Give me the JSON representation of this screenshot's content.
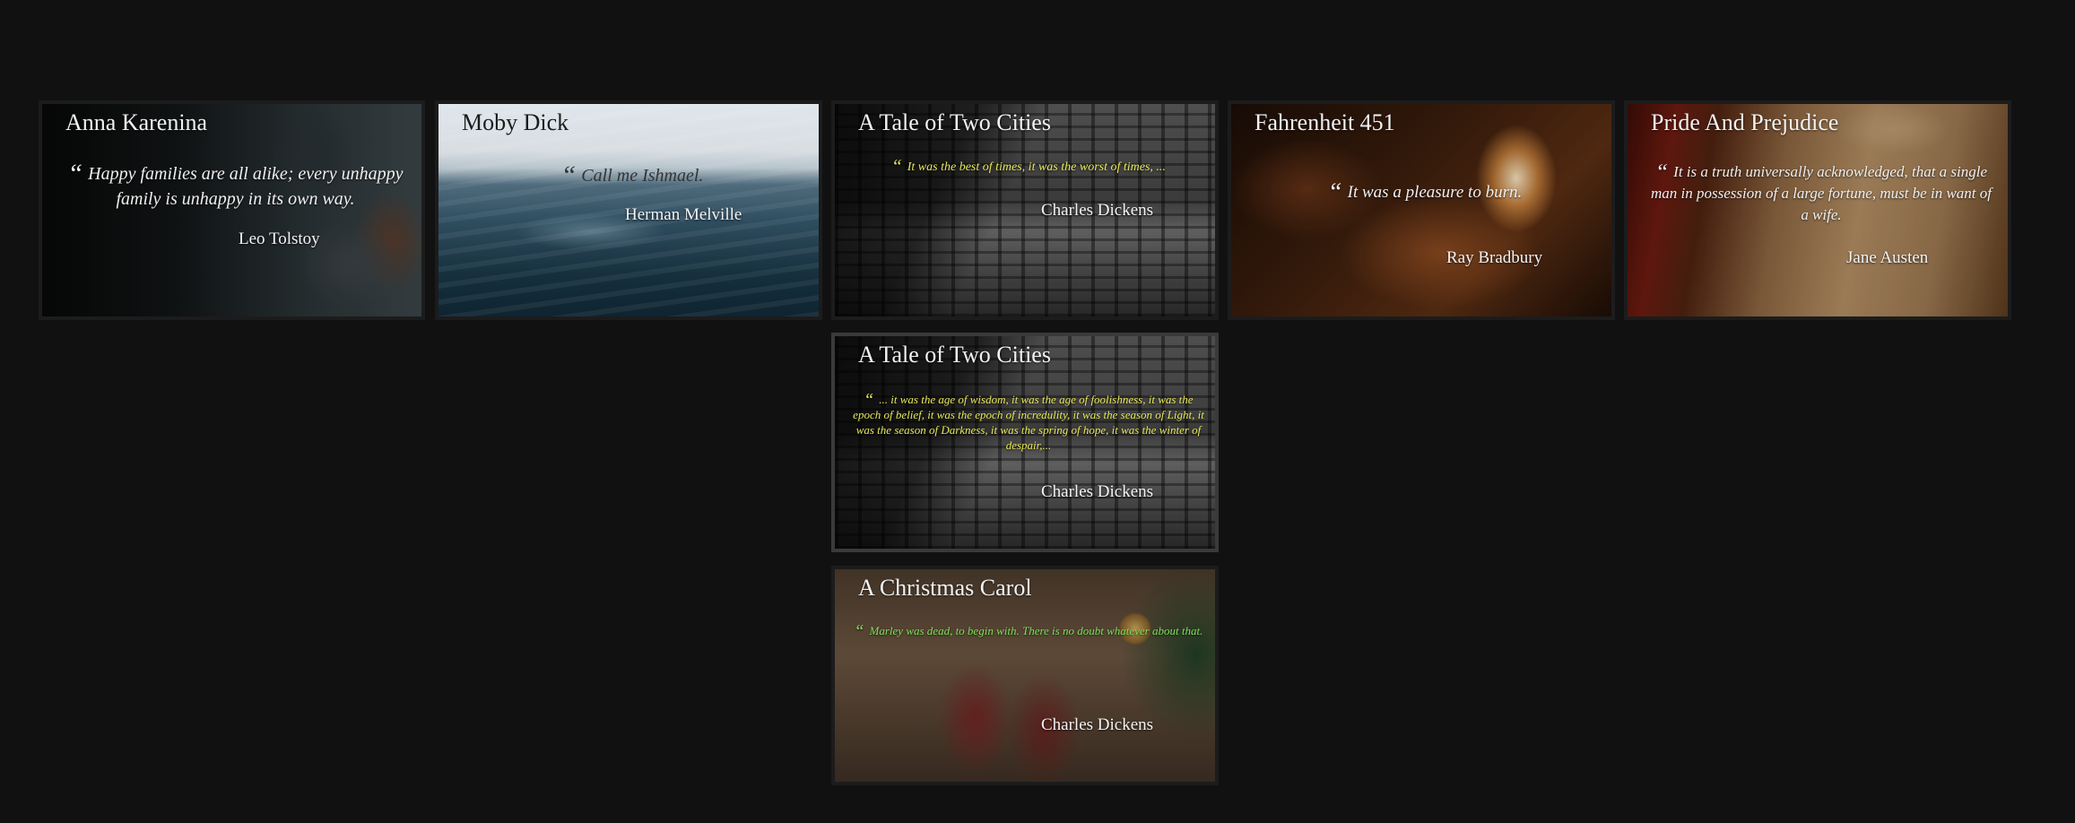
{
  "cards": [
    {
      "title": "Anna Karenina",
      "quote_mark": "“",
      "quote": "Happy families are all alike; every unhappy family is unhappy in its own way.",
      "author": "Leo Tolstoy",
      "quote_color": "#f0f0f0"
    },
    {
      "title": "Moby Dick",
      "quote_mark": "“",
      "quote": "Call me Ishmael.",
      "author": "Herman Melville",
      "quote_color": "#333333"
    },
    {
      "title": "A Tale of Two Cities",
      "quote_mark": "“",
      "quote": "It was the best of times, it was the worst of times, ...",
      "author": "Charles Dickens",
      "quote_color": "#e8e85a"
    },
    {
      "title": "Fahrenheit 451",
      "quote_mark": "“",
      "quote": "It was a pleasure to burn.",
      "author": "Ray Bradbury",
      "quote_color": "#f4f4f4"
    },
    {
      "title": "Pride And Prejudice",
      "quote_mark": "“",
      "quote": "It is a truth universally acknowledged, that a single man in possession of a large fortune, must be in want of a wife.",
      "author": "Jane Austen",
      "quote_color": "#f4f4f4"
    },
    {
      "title": "A Tale of Two Cities",
      "quote_mark": "“",
      "quote": "... it was the age of wisdom, it was the age of foolishness, it was the epoch of belief, it was the epoch of incredulity, it was the season of Light, it was the season of Darkness, it was the spring of hope, it was the winter of despair,...",
      "author": "Charles Dickens",
      "quote_color": "#e8e85a"
    },
    {
      "title": "A Christmas Carol",
      "quote_mark": "“",
      "quote": "Marley was dead, to begin with. There is no doubt whatever about that.",
      "author": "Charles Dickens",
      "quote_color": "#7ee05a"
    }
  ]
}
